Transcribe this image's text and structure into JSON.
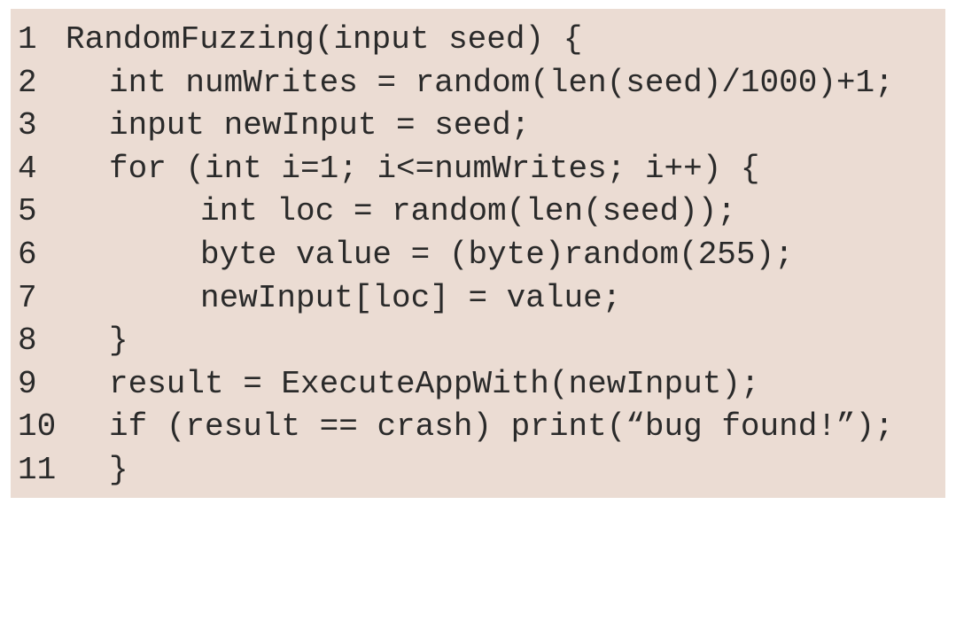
{
  "code": {
    "lines": [
      {
        "number": "1",
        "text": "RandomFuzzing(input seed) {"
      },
      {
        "number": "2",
        "text": "int numWrites = random(len(seed)/1000)+1;"
      },
      {
        "number": "3",
        "text": "input newInput = seed;"
      },
      {
        "number": "4",
        "text": "for (int i=1; i<=numWrites; i++) {"
      },
      {
        "number": "5",
        "text": "int loc = random(len(seed));"
      },
      {
        "number": "6",
        "text": "byte value = (byte)random(255);"
      },
      {
        "number": "7",
        "text": "newInput[loc] = value;"
      },
      {
        "number": "8",
        "text": "}"
      },
      {
        "number": "9",
        "text": "result = ExecuteAppWith(newInput);"
      },
      {
        "number": "10",
        "text": "if (result == crash) print(“bug found!”);"
      },
      {
        "number": "11",
        "text": "}"
      }
    ]
  },
  "colors": {
    "background": "#ebdcd3",
    "text": "#2a2a2a"
  }
}
